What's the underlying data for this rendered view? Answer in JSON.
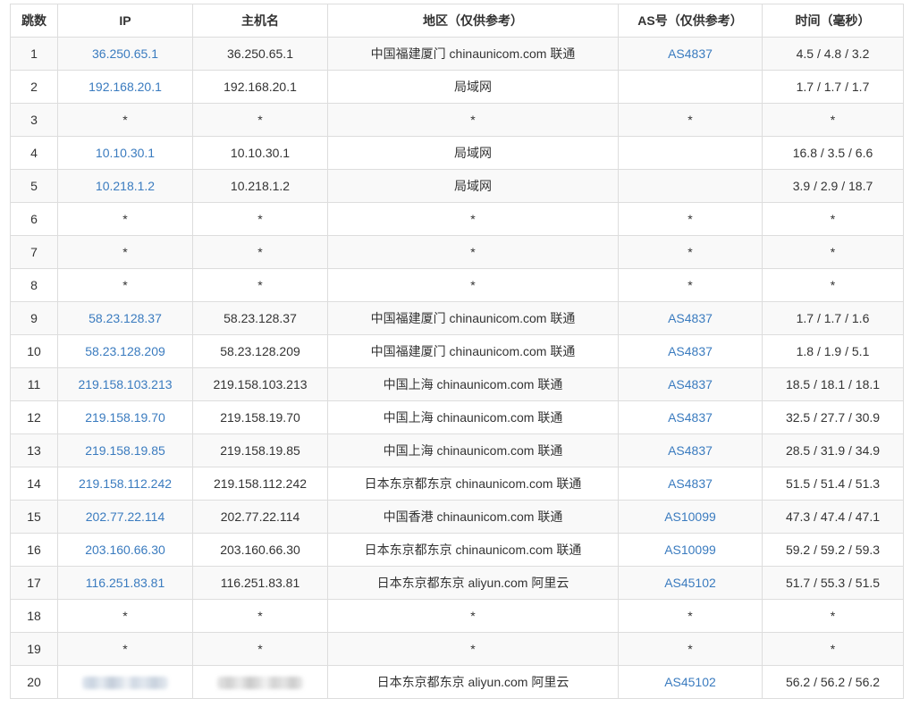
{
  "table": {
    "headers": {
      "hop": "跳数",
      "ip": "IP",
      "host": "主机名",
      "region": "地区（仅供参考）",
      "as": "AS号（仅供参考）",
      "time": "时间（毫秒）"
    },
    "rows": [
      {
        "hop": "1",
        "ip": "36.250.65.1",
        "host": "36.250.65.1",
        "region": "中国福建厦门 chinaunicom.com 联通",
        "as": "AS4837",
        "time": "4.5 / 4.8 / 3.2"
      },
      {
        "hop": "2",
        "ip": "192.168.20.1",
        "host": "192.168.20.1",
        "region": "局域网",
        "as": "",
        "time": "1.7 / 1.7 / 1.7"
      },
      {
        "hop": "3",
        "ip": "*",
        "host": "*",
        "region": "*",
        "as": "*",
        "time": "*"
      },
      {
        "hop": "4",
        "ip": "10.10.30.1",
        "host": "10.10.30.1",
        "region": "局域网",
        "as": "",
        "time": "16.8 / 3.5 / 6.6"
      },
      {
        "hop": "5",
        "ip": "10.218.1.2",
        "host": "10.218.1.2",
        "region": "局域网",
        "as": "",
        "time": "3.9 / 2.9 / 18.7"
      },
      {
        "hop": "6",
        "ip": "*",
        "host": "*",
        "region": "*",
        "as": "*",
        "time": "*"
      },
      {
        "hop": "7",
        "ip": "*",
        "host": "*",
        "region": "*",
        "as": "*",
        "time": "*"
      },
      {
        "hop": "8",
        "ip": "*",
        "host": "*",
        "region": "*",
        "as": "*",
        "time": "*"
      },
      {
        "hop": "9",
        "ip": "58.23.128.37",
        "host": "58.23.128.37",
        "region": "中国福建厦门 chinaunicom.com 联通",
        "as": "AS4837",
        "time": "1.7 / 1.7 / 1.6"
      },
      {
        "hop": "10",
        "ip": "58.23.128.209",
        "host": "58.23.128.209",
        "region": "中国福建厦门 chinaunicom.com 联通",
        "as": "AS4837",
        "time": "1.8 / 1.9 / 5.1"
      },
      {
        "hop": "11",
        "ip": "219.158.103.213",
        "host": "219.158.103.213",
        "region": "中国上海 chinaunicom.com 联通",
        "as": "AS4837",
        "time": "18.5 / 18.1 / 18.1"
      },
      {
        "hop": "12",
        "ip": "219.158.19.70",
        "host": "219.158.19.70",
        "region": "中国上海 chinaunicom.com 联通",
        "as": "AS4837",
        "time": "32.5 / 27.7 / 30.9"
      },
      {
        "hop": "13",
        "ip": "219.158.19.85",
        "host": "219.158.19.85",
        "region": "中国上海 chinaunicom.com 联通",
        "as": "AS4837",
        "time": "28.5 / 31.9 / 34.9"
      },
      {
        "hop": "14",
        "ip": "219.158.112.242",
        "host": "219.158.112.242",
        "region": "日本东京都东京 chinaunicom.com 联通",
        "as": "AS4837",
        "time": "51.5 / 51.4 / 51.3"
      },
      {
        "hop": "15",
        "ip": "202.77.22.114",
        "host": "202.77.22.114",
        "region": "中国香港 chinaunicom.com 联通",
        "as": "AS10099",
        "time": "47.3 / 47.4 / 47.1"
      },
      {
        "hop": "16",
        "ip": "203.160.66.30",
        "host": "203.160.66.30",
        "region": "日本东京都东京 chinaunicom.com 联通",
        "as": "AS10099",
        "time": "59.2 / 59.2 / 59.3"
      },
      {
        "hop": "17",
        "ip": "116.251.83.81",
        "host": "116.251.83.81",
        "region": "日本东京都东京 aliyun.com 阿里云",
        "as": "AS45102",
        "time": "51.7 / 55.3 / 51.5"
      },
      {
        "hop": "18",
        "ip": "*",
        "host": "*",
        "region": "*",
        "as": "*",
        "time": "*"
      },
      {
        "hop": "19",
        "ip": "*",
        "host": "*",
        "region": "*",
        "as": "*",
        "time": "*"
      },
      {
        "hop": "20",
        "ip": "",
        "host": "",
        "region": "日本东京都东京 aliyun.com 阿里云",
        "as": "AS45102",
        "time": "56.2 / 56.2 / 56.2",
        "masked": true
      }
    ]
  },
  "colors": {
    "link": "#3a7bbf",
    "border": "#dddddd",
    "stripe": "#f9f9f9",
    "text": "#333333"
  }
}
